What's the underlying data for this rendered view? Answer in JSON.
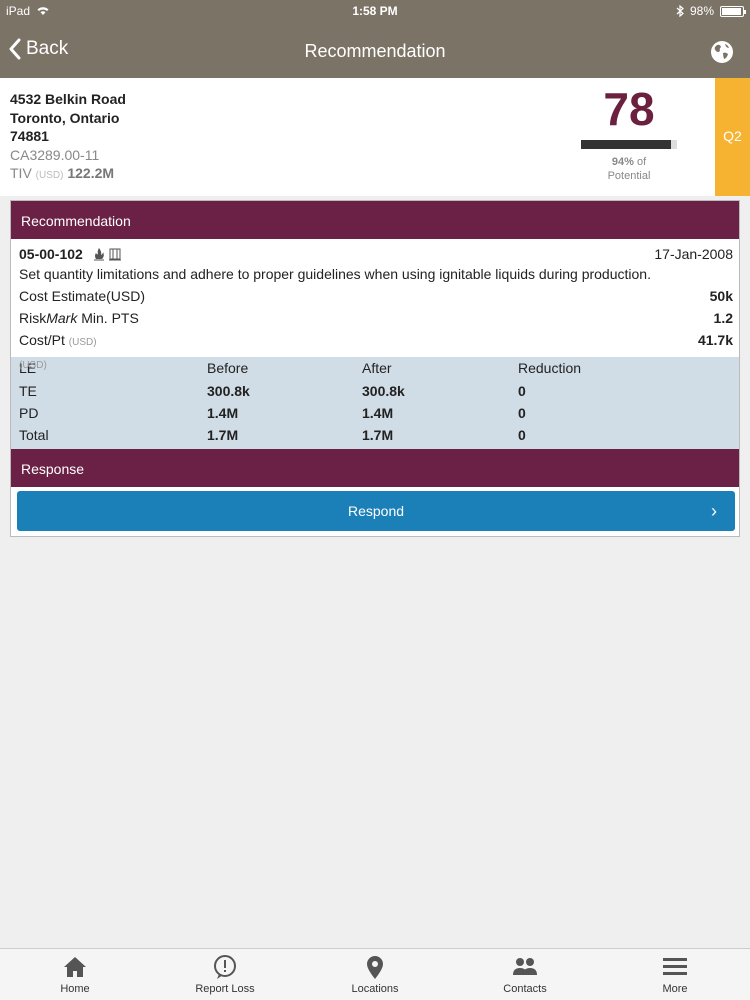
{
  "status_bar": {
    "device": "iPad",
    "time": "1:58 PM",
    "battery": "98%"
  },
  "nav": {
    "back_label": "Back",
    "title": "Recommendation"
  },
  "location": {
    "street": "4532 Belkin Road",
    "city": "Toronto, Ontario",
    "postal": "74881",
    "account": "CA3289.00-11",
    "tiv_label": "TIV",
    "tiv_unit": "(USD)",
    "tiv_value": "122.2M"
  },
  "score": {
    "value": "78",
    "potential_pct": "94%",
    "potential_of": "of",
    "potential_label": "Potential",
    "bar_fraction": 0.94
  },
  "quarter": "Q2",
  "recommendation": {
    "header": "Recommendation",
    "id": "05-00-102",
    "date": "17-Jan-2008",
    "text": "Set quantity limitations and adhere to proper guidelines when using ignitable liquids during production.",
    "cost_estimate_label": "Cost Estimate(USD)",
    "cost_estimate_value": "50k",
    "riskmark_prefix": "Risk",
    "riskmark_italic": "Mark",
    "riskmark_suffix": " Min. PTS",
    "riskmark_value": "1.2",
    "cost_pt_label": "Cost/Pt",
    "cost_pt_unit": "(USD)",
    "cost_pt_value": "41.7k"
  },
  "le_table": {
    "header": {
      "label": "LE",
      "unit": "(USD)",
      "before": "Before",
      "after": "After",
      "reduction": "Reduction"
    },
    "rows": [
      {
        "label": "TE",
        "before": "300.8k",
        "after": "300.8k",
        "reduction": "0"
      },
      {
        "label": "PD",
        "before": "1.4M",
        "after": "1.4M",
        "reduction": "0"
      },
      {
        "label": "Total",
        "before": "1.7M",
        "after": "1.7M",
        "reduction": "0"
      }
    ]
  },
  "response": {
    "header": "Response",
    "button_label": "Respond"
  },
  "tabs": [
    {
      "label": "Home",
      "icon": "home-icon"
    },
    {
      "label": "Report Loss",
      "icon": "alert-icon"
    },
    {
      "label": "Locations",
      "icon": "location-pin-icon"
    },
    {
      "label": "Contacts",
      "icon": "contacts-icon"
    },
    {
      "label": "More",
      "icon": "menu-icon"
    }
  ],
  "colors": {
    "nav_bg": "#7c7367",
    "maroon": "#6a2145",
    "quarter": "#f5b331",
    "respond_button": "#1b80b8",
    "table_bg": "#d1dde6"
  }
}
